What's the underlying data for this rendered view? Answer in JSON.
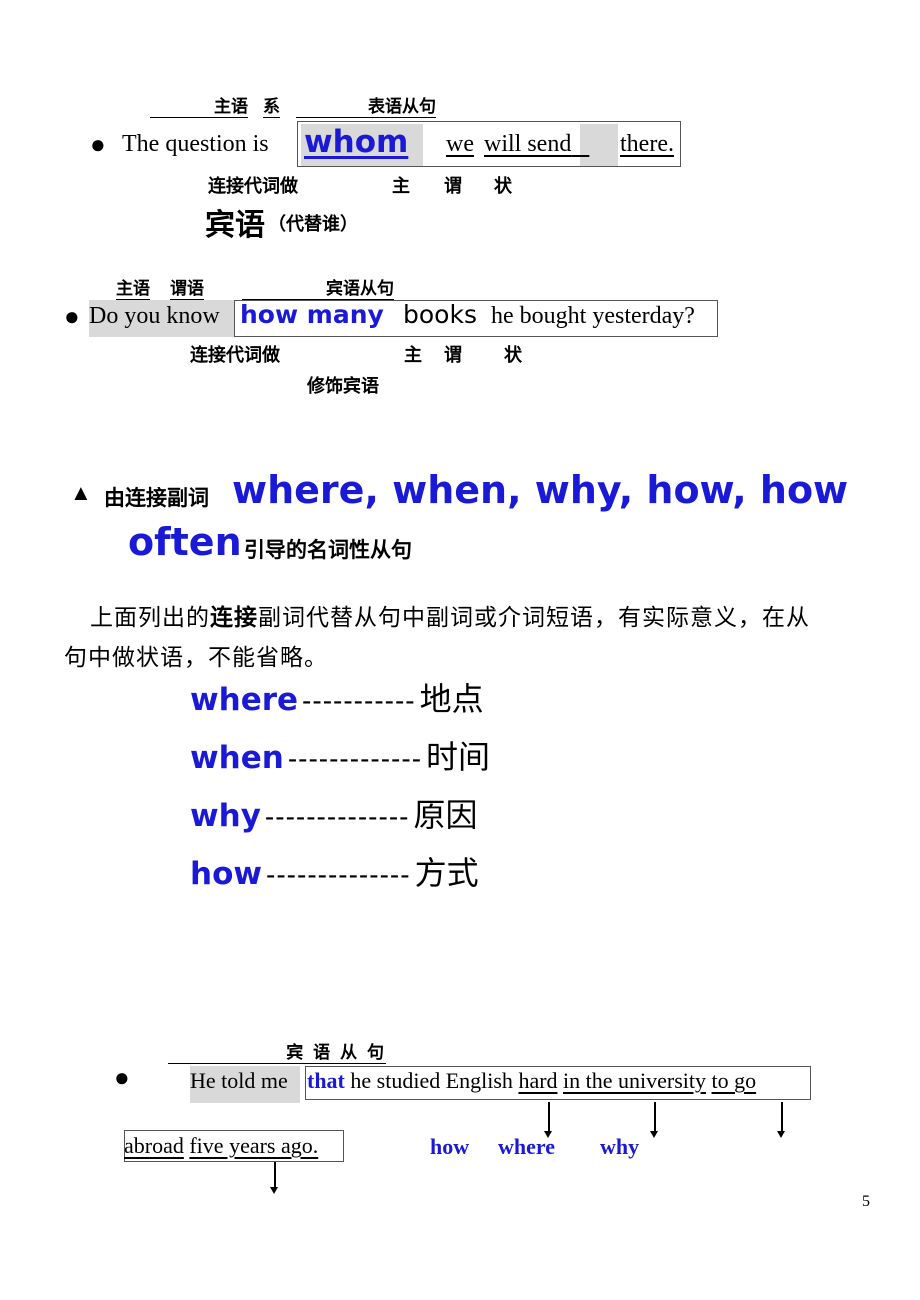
{
  "example1": {
    "labels": {
      "subject": "主语",
      "linking": "系",
      "clause": "表语从句"
    },
    "bullet": "●",
    "lead": "The question  is",
    "connector": "whom",
    "words": [
      "we",
      "will send",
      "there."
    ],
    "under_labels": {
      "connector_role": "连接代词做",
      "s": "主",
      "v": "谓",
      "adv": "状"
    },
    "role_big": "宾语",
    "role_note": "（代替谁）"
  },
  "example2": {
    "labels": {
      "subject": "主语",
      "predicate": "谓语",
      "clause": "宾语从句"
    },
    "bullet": "●",
    "lead": "Do you know",
    "connector": "how many",
    "object": "books",
    "rest": "he bought yesterday?",
    "under_labels": {
      "connector_role": "连接代词做",
      "s": "主",
      "v": "谓",
      "adv": "状",
      "modifier": "修饰宾语"
    }
  },
  "section": {
    "marker": "▲",
    "prefix": "由连接副词",
    "words_line1": "where, when, why, how, how",
    "words_line2": "often",
    "suffix": "引导的名词性从句"
  },
  "paragraph": {
    "line1_a": "上面列出的",
    "line1_bold": "连接",
    "line1_b": "副词代替从句中副词或介词短语，有实际意义，在从",
    "line2": "句中做状语，不能省略。"
  },
  "mapping": [
    {
      "word": "where",
      "dashes": "-----------",
      "meaning": "地点"
    },
    {
      "word": "when",
      "dashes": "-------------",
      "meaning": "时间"
    },
    {
      "word": "why",
      "dashes": "--------------",
      "meaning": "原因"
    },
    {
      "word": "how",
      "dashes": "--------------",
      "meaning": "方式"
    }
  ],
  "example3": {
    "clause_label": "宾 语 从 句",
    "bullet": "●",
    "lead": "He told me",
    "connector": "that",
    "plain": "he studied English",
    "u1": "hard",
    "u2": "in the university",
    "u3": "to go",
    "line2_u1": "abroad",
    "line2_u2": "five years ago.",
    "answers": [
      "how",
      "where",
      "why"
    ]
  },
  "page_number": "5"
}
